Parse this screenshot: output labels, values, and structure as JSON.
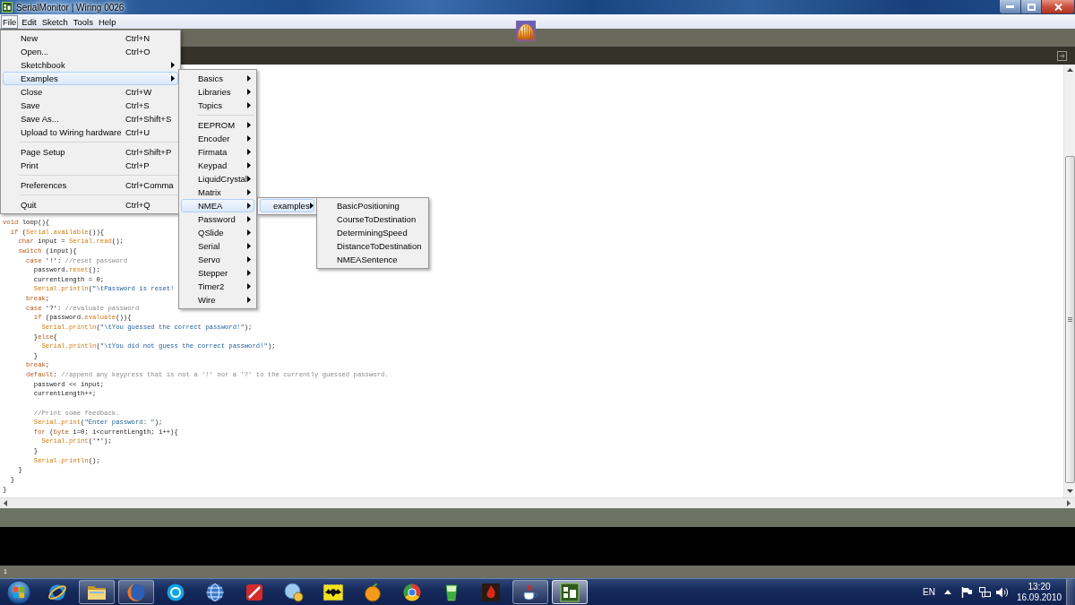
{
  "window": {
    "title": "SerialMonitor | Wiring 0026"
  },
  "menu_bar": [
    {
      "label": "File",
      "selected": true
    },
    {
      "label": "Edit",
      "selected": false
    },
    {
      "label": "Sketch",
      "selected": false
    },
    {
      "label": "Tools",
      "selected": false
    },
    {
      "label": "Help",
      "selected": false
    }
  ],
  "file_menu": {
    "groups": [
      {
        "items": [
          {
            "kind": "action",
            "label": "New",
            "shortcut": "Ctrl+N",
            "selected": false
          },
          {
            "kind": "action",
            "label": "Open...",
            "shortcut": "Ctrl+O",
            "selected": false
          },
          {
            "kind": "submenu",
            "label": "Sketchbook",
            "selected": false
          },
          {
            "kind": "submenu",
            "label": "Examples",
            "selected": true
          },
          {
            "kind": "action",
            "label": "Close",
            "shortcut": "Ctrl+W",
            "selected": false
          },
          {
            "kind": "action",
            "label": "Save",
            "shortcut": "Ctrl+S",
            "selected": false
          },
          {
            "kind": "action",
            "label": "Save As...",
            "shortcut": "Ctrl+Shift+S",
            "selected": false
          },
          {
            "kind": "action",
            "label": "Upload to Wiring hardware",
            "shortcut": "Ctrl+U",
            "selected": false
          }
        ]
      },
      {
        "items": [
          {
            "kind": "action",
            "label": "Page Setup",
            "shortcut": "Ctrl+Shift+P",
            "selected": false
          },
          {
            "kind": "action",
            "label": "Print",
            "shortcut": "Ctrl+P",
            "selected": false
          }
        ]
      },
      {
        "items": [
          {
            "kind": "action",
            "label": "Preferences",
            "shortcut": "Ctrl+Comma",
            "selected": false
          }
        ]
      },
      {
        "items": [
          {
            "kind": "action",
            "label": "Quit",
            "shortcut": "Ctrl+Q",
            "selected": false
          }
        ]
      }
    ]
  },
  "examples_menu": {
    "groups": [
      {
        "items": [
          {
            "kind": "submenu",
            "label": "Basics",
            "selected": false
          },
          {
            "kind": "submenu",
            "label": "Libraries",
            "selected": false
          },
          {
            "kind": "submenu",
            "label": "Topics",
            "selected": false
          }
        ]
      },
      {
        "items": [
          {
            "kind": "submenu",
            "label": "EEPROM",
            "selected": false
          },
          {
            "kind": "submenu",
            "label": "Encoder",
            "selected": false
          },
          {
            "kind": "submenu",
            "label": "Firmata",
            "selected": false
          },
          {
            "kind": "submenu",
            "label": "Keypad",
            "selected": false
          },
          {
            "kind": "submenu",
            "label": "LiquidCrystal",
            "selected": false
          },
          {
            "kind": "submenu",
            "label": "Matrix",
            "selected": false
          },
          {
            "kind": "submenu",
            "label": "NMEA",
            "selected": true
          },
          {
            "kind": "submenu",
            "label": "Password",
            "selected": false
          },
          {
            "kind": "submenu",
            "label": "QSlide",
            "selected": false
          },
          {
            "kind": "submenu",
            "label": "Serial",
            "selected": false
          },
          {
            "kind": "submenu",
            "label": "Servo",
            "selected": false
          },
          {
            "kind": "submenu",
            "label": "Stepper",
            "selected": false
          },
          {
            "kind": "submenu",
            "label": "Timer2",
            "selected": false
          },
          {
            "kind": "submenu",
            "label": "Wire",
            "selected": false
          }
        ]
      }
    ]
  },
  "nmea_menu": {
    "groups": [
      {
        "items": [
          {
            "kind": "submenu",
            "label": "examples",
            "selected": true
          }
        ]
      }
    ]
  },
  "nmea_examples_menu": {
    "groups": [
      {
        "items": [
          {
            "kind": "action",
            "label": "BasicPositioning",
            "selected": false
          },
          {
            "kind": "action",
            "label": "CourseToDestination",
            "selected": false
          },
          {
            "kind": "action",
            "label": "DeterminingSpeed",
            "selected": false
          },
          {
            "kind": "action",
            "label": "DistanceToDestination",
            "selected": false
          },
          {
            "kind": "action",
            "label": "NMEASentence",
            "selected": false
          }
        ]
      }
    ]
  },
  "editor": {
    "lines": [
      {
        "tokens": [
          {
            "kind": "keyword",
            "text": "void"
          },
          {
            "kind": "plain",
            "text": " loop(){"
          }
        ],
        "children": [
          {
            "tokens": [
              {
                "kind": "keyword",
                "text": "if"
              },
              {
                "kind": "plain",
                "text": " ("
              },
              {
                "kind": "function",
                "text": "Serial.available"
              },
              {
                "kind": "plain",
                "text": "()){"
              }
            ],
            "children": [
              {
                "tokens": [
                  {
                    "kind": "keyword",
                    "text": "char"
                  },
                  {
                    "kind": "plain",
                    "text": " input = "
                  },
                  {
                    "kind": "function",
                    "text": "Serial.read"
                  },
                  {
                    "kind": "plain",
                    "text": "();"
                  }
                ]
              },
              {
                "tokens": [
                  {
                    "kind": "keyword",
                    "text": "switch"
                  },
                  {
                    "kind": "plain",
                    "text": " (input){"
                  }
                ],
                "children": [
                  {
                    "tokens": [
                      {
                        "kind": "keyword",
                        "text": "case"
                      },
                      {
                        "kind": "plain",
                        "text": " '!': "
                      },
                      {
                        "kind": "comment",
                        "text": "//reset password"
                      }
                    ],
                    "children": [
                      {
                        "tokens": [
                          {
                            "kind": "plain",
                            "text": "password."
                          },
                          {
                            "kind": "function",
                            "text": "reset"
                          },
                          {
                            "kind": "plain",
                            "text": "();"
                          }
                        ]
                      },
                      {
                        "tokens": [
                          {
                            "kind": "plain",
                            "text": "currentLength = 0;"
                          }
                        ]
                      },
                      {
                        "tokens": [
                          {
                            "kind": "function",
                            "text": "Serial.println"
                          },
                          {
                            "kind": "plain",
                            "text": "("
                          },
                          {
                            "kind": "string",
                            "text": "\"\\tPassword is reset!"
                          }
                        ]
                      }
                    ]
                  },
                  {
                    "tokens": [
                      {
                        "kind": "keyword",
                        "text": "break"
                      },
                      {
                        "kind": "plain",
                        "text": ";"
                      }
                    ]
                  },
                  {
                    "tokens": [
                      {
                        "kind": "keyword",
                        "text": "case"
                      },
                      {
                        "kind": "plain",
                        "text": " '?': "
                      },
                      {
                        "kind": "comment",
                        "text": "//evaluate password"
                      }
                    ],
                    "children": [
                      {
                        "tokens": [
                          {
                            "kind": "keyword",
                            "text": "if"
                          },
                          {
                            "kind": "plain",
                            "text": " (password."
                          },
                          {
                            "kind": "function",
                            "text": "evaluate"
                          },
                          {
                            "kind": "plain",
                            "text": "()){"
                          }
                        ],
                        "children": [
                          {
                            "tokens": [
                              {
                                "kind": "function",
                                "text": "Serial.println"
                              },
                              {
                                "kind": "plain",
                                "text": "("
                              },
                              {
                                "kind": "string",
                                "text": "\"\\tYou guessed the correct password!\""
                              },
                              {
                                "kind": "plain",
                                "text": ");"
                              }
                            ]
                          }
                        ]
                      },
                      {
                        "tokens": [
                          {
                            "kind": "plain",
                            "text": "}"
                          },
                          {
                            "kind": "keyword",
                            "text": "else"
                          },
                          {
                            "kind": "plain",
                            "text": "{"
                          }
                        ],
                        "children": [
                          {
                            "tokens": [
                              {
                                "kind": "function",
                                "text": "Serial.println"
                              },
                              {
                                "kind": "plain",
                                "text": "("
                              },
                              {
                                "kind": "string",
                                "text": "\"\\tYou did not guess the correct password!\""
                              },
                              {
                                "kind": "plain",
                                "text": ");"
                              }
                            ]
                          }
                        ]
                      },
                      {
                        "tokens": [
                          {
                            "kind": "plain",
                            "text": "}"
                          }
                        ]
                      }
                    ]
                  },
                  {
                    "tokens": [
                      {
                        "kind": "keyword",
                        "text": "break"
                      },
                      {
                        "kind": "plain",
                        "text": ";"
                      }
                    ]
                  },
                  {
                    "tokens": [
                      {
                        "kind": "keyword",
                        "text": "default"
                      },
                      {
                        "kind": "plain",
                        "text": ": "
                      },
                      {
                        "kind": "comment",
                        "text": "//append any keypress that is not a '!' nor a '?' to the currently guessed password."
                      }
                    ],
                    "children": [
                      {
                        "kind": "code",
                        "tokens": [
                          {
                            "kind": "plain",
                            "text": "password << input;"
                          }
                        ]
                      },
                      {
                        "kind": "code",
                        "tokens": [
                          {
                            "kind": "plain",
                            "text": "currentLength++;"
                          }
                        ]
                      },
                      {
                        "kind": "blank"
                      },
                      {
                        "kind": "code",
                        "tokens": [
                          {
                            "kind": "comment",
                            "text": "//Print some feedback."
                          }
                        ]
                      },
                      {
                        "kind": "code",
                        "tokens": [
                          {
                            "kind": "function",
                            "text": "Serial.print"
                          },
                          {
                            "kind": "plain",
                            "text": "("
                          },
                          {
                            "kind": "string",
                            "text": "\"Enter password: \""
                          },
                          {
                            "kind": "plain",
                            "text": ");"
                          }
                        ]
                      },
                      {
                        "kind": "code",
                        "tokens": [
                          {
                            "kind": "keyword",
                            "text": "for"
                          },
                          {
                            "kind": "plain",
                            "text": " ("
                          },
                          {
                            "kind": "keyword",
                            "text": "byte"
                          },
                          {
                            "kind": "plain",
                            "text": " i=0; i<currentLength; i++){"
                          }
                        ],
                        "children": [
                          {
                            "tokens": [
                              {
                                "kind": "function",
                                "text": "Serial.print"
                              },
                              {
                                "kind": "plain",
                                "text": "('*');"
                              }
                            ]
                          }
                        ]
                      },
                      {
                        "kind": "code",
                        "tokens": [
                          {
                            "kind": "plain",
                            "text": "}"
                          }
                        ]
                      },
                      {
                        "kind": "code",
                        "tokens": [
                          {
                            "kind": "function",
                            "text": "Serial.println"
                          },
                          {
                            "kind": "plain",
                            "text": "();"
                          }
                        ]
                      }
                    ]
                  }
                ]
              },
              {
                "tokens": [
                  {
                    "kind": "plain",
                    "text": "}"
                  }
                ]
              }
            ]
          },
          {
            "tokens": [
              {
                "kind": "plain",
                "text": "}"
              }
            ]
          }
        ]
      },
      {
        "tokens": [
          {
            "kind": "plain",
            "text": "}"
          }
        ]
      }
    ]
  },
  "status": {
    "line_number": "1"
  },
  "taskbar": {
    "buttons": [
      {
        "running": false,
        "selected": false
      },
      {
        "running": true,
        "selected": false
      },
      {
        "running": true,
        "selected": false
      },
      {
        "running": false,
        "selected": false
      },
      {
        "running": false,
        "selected": false
      },
      {
        "running": false,
        "selected": false
      },
      {
        "running": false,
        "selected": false
      },
      {
        "running": false,
        "selected": false
      },
      {
        "running": false,
        "selected": false
      },
      {
        "running": false,
        "selected": false
      },
      {
        "running": false,
        "selected": false
      },
      {
        "running": false,
        "selected": false
      },
      {
        "running": true,
        "selected": false
      },
      {
        "running": true,
        "selected": true
      }
    ],
    "tray": {
      "language": "EN",
      "time": "13:20",
      "date": "16.09.2010"
    }
  }
}
